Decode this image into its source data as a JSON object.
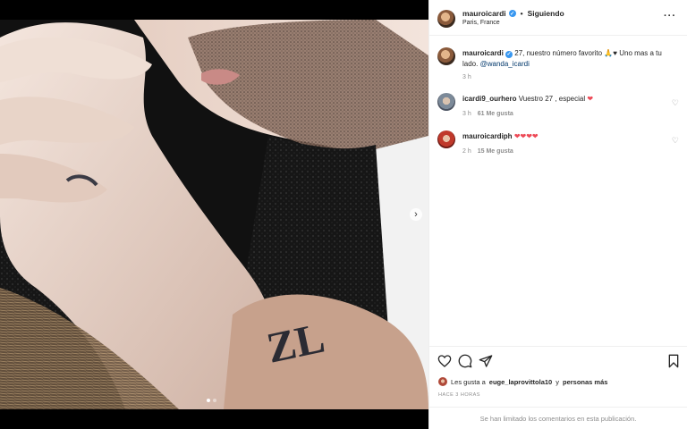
{
  "post": {
    "username": "mauroicardi",
    "separator": "•",
    "follow_label": "Siguiendo",
    "location": "Paris, France",
    "more_icon": "more-options-icon"
  },
  "caption": {
    "username": "mauroicardi",
    "text": "27, nuestro número favorito 🙏♥ Uno mas a tu lado.",
    "mention": "@wanda_icardi",
    "time": "3 h"
  },
  "comments": [
    {
      "username": "icardi9_ourhero",
      "text": "Vuestro 27 , especial",
      "emoji": "❤",
      "time": "3 h",
      "likes": "61 Me gusta"
    },
    {
      "username": "mauroicardiph",
      "text": "",
      "emoji": "❤❤❤❤",
      "time": "2 h",
      "likes": "15 Me gusta"
    }
  ],
  "carousel": {
    "current": 1,
    "total": 2,
    "next_icon": "chevron-right-icon"
  },
  "actions": {
    "icons": [
      "heart-icon",
      "comment-icon",
      "share-icon",
      "bookmark-icon"
    ],
    "liked_prefix": "Les gusta a",
    "liked_user": "euge_laprovittola10",
    "liked_joiner": "y",
    "liked_more": "personas más",
    "timestamp": "HACE 3 HORAS"
  },
  "footer": {
    "notice": "Se han limitado los comentarios en esta publicación."
  },
  "colors": {
    "verified": "#3897f0",
    "heart": "#ed4956",
    "meta": "#8e8e8e"
  }
}
